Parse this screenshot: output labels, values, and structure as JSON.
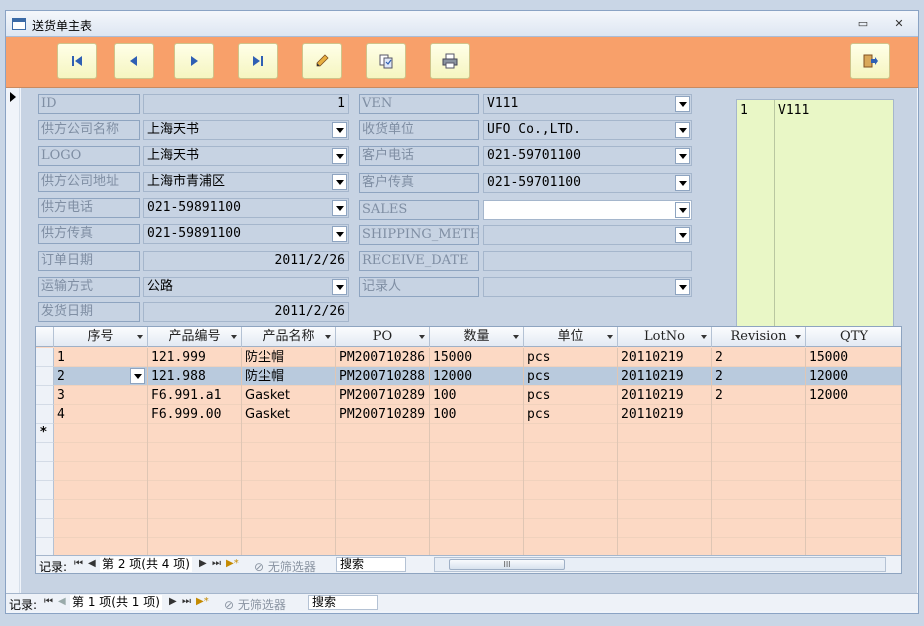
{
  "window": {
    "title": "送货单主表",
    "minimize": "▭",
    "close": "✕"
  },
  "toolbar": {
    "buttons": [
      {
        "name": "first-record-icon"
      },
      {
        "name": "previous-record-icon"
      },
      {
        "name": "next-record-icon"
      },
      {
        "name": "last-record-icon"
      },
      {
        "name": "edit-pencil-icon"
      },
      {
        "name": "copy-doc-icon"
      },
      {
        "name": "print-icon"
      },
      {
        "name": "exit-door-icon"
      }
    ]
  },
  "form": {
    "left": [
      {
        "label": "ID",
        "value": "1",
        "align": "right",
        "dropdown": false
      },
      {
        "label": "供方公司名称",
        "value": "上海天书",
        "dropdown": true
      },
      {
        "label": "LOGO",
        "value": "上海天书",
        "dropdown": true
      },
      {
        "label": "供方公司地址",
        "value": "上海市青浦区",
        "dropdown": true
      },
      {
        "label": "供方电话",
        "value": "021-59891100",
        "dropdown": true
      },
      {
        "label": "供方传真",
        "value": "021-59891100",
        "dropdown": true
      },
      {
        "label": "订单日期",
        "value": "2011/2/26",
        "align": "right",
        "dropdown": false
      },
      {
        "label": "运输方式",
        "value": "公路",
        "dropdown": true
      },
      {
        "label": "发货日期",
        "value": "2011/2/26",
        "align": "right",
        "dropdown": false
      }
    ],
    "right": [
      {
        "label": "VEN",
        "value": "V111",
        "dropdown": true
      },
      {
        "label": "收货单位",
        "value": "UFO Co.,LTD.",
        "dropdown": true
      },
      {
        "label": "客户电话",
        "value": "021-59701100",
        "dropdown": true
      },
      {
        "label": "客户传真",
        "value": "021-59701100",
        "dropdown": true
      },
      {
        "label": "SALES",
        "value": "",
        "dropdown": true,
        "white": true
      },
      {
        "label": "SHIPPING_METHOD",
        "value": "",
        "dropdown": true
      },
      {
        "label": "RECEIVE_DATE",
        "value": "",
        "dropdown": false
      },
      {
        "label": "记录人",
        "value": "",
        "dropdown": true
      }
    ],
    "listbox": {
      "c1": "1",
      "c2": "V111"
    }
  },
  "subform": {
    "headers": [
      "序号",
      "产品编号",
      "产品名称",
      "PO",
      "数量",
      "单位",
      "LotNo",
      "Revision",
      "QTY"
    ],
    "rows": [
      [
        "1",
        "121.999",
        "防尘帽",
        "PM200710286",
        "15000",
        "pcs",
        "20110219",
        "2",
        "15000"
      ],
      [
        "2",
        "121.988",
        "防尘帽",
        "PM200710288",
        "12000",
        "pcs",
        "20110219",
        "2",
        "12000"
      ],
      [
        "3",
        "F6.991.a1",
        "Gasket",
        "PM200710289",
        "100",
        "pcs",
        "20110219",
        "2",
        "12000"
      ],
      [
        "4",
        "F6.999.00",
        "Gasket",
        "PM200710289",
        "100",
        "pcs",
        "20110219",
        "",
        ""
      ]
    ],
    "selected_row": 1,
    "new_row_marker": "*",
    "nav": {
      "label": "记录:",
      "position": "第 2 项(共 4 项)",
      "filter": "无筛选器",
      "search": "搜索",
      "scroll_mark": "III"
    }
  },
  "mainnav": {
    "label": "记录:",
    "position": "第 1 项(共 1 项)",
    "filter": "无筛选器",
    "search": "搜索"
  }
}
